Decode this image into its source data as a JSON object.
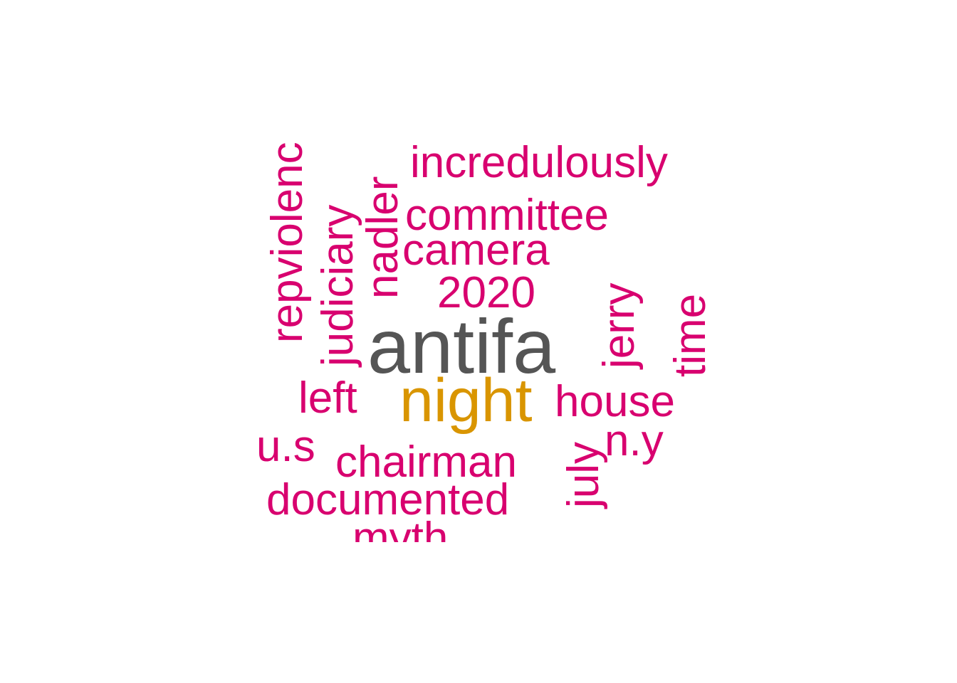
{
  "colors": {
    "primary": "#555555",
    "secondary": "#D99500",
    "tertiary": "#D8006F"
  },
  "words": [
    {
      "key": "antifa",
      "text": "antifa",
      "weight": 1,
      "color": "primary"
    },
    {
      "key": "night",
      "text": "night",
      "weight": 2,
      "color": "secondary"
    },
    {
      "key": "incredulously",
      "text": "incredulously",
      "weight": 3,
      "color": "tertiary"
    },
    {
      "key": "committee",
      "text": "committee",
      "weight": 3,
      "color": "tertiary"
    },
    {
      "key": "camera",
      "text": "camera",
      "weight": 3,
      "color": "tertiary"
    },
    {
      "key": "2020",
      "text": "2020",
      "weight": 3,
      "color": "tertiary"
    },
    {
      "key": "house",
      "text": "house",
      "weight": 3,
      "color": "tertiary"
    },
    {
      "key": "left",
      "text": "left",
      "weight": 3,
      "color": "tertiary"
    },
    {
      "key": "u-s",
      "text": "u.s",
      "weight": 3,
      "color": "tertiary"
    },
    {
      "key": "n-y",
      "text": "n.y",
      "weight": 3,
      "color": "tertiary"
    },
    {
      "key": "chairman",
      "text": "chairman",
      "weight": 3,
      "color": "tertiary"
    },
    {
      "key": "documented",
      "text": "documented",
      "weight": 3,
      "color": "tertiary"
    },
    {
      "key": "myth",
      "text": "myth",
      "weight": 3,
      "color": "tertiary"
    },
    {
      "key": "repviolenc",
      "text": "repviolenc",
      "weight": 3,
      "color": "tertiary"
    },
    {
      "key": "judiciary",
      "text": "judiciary",
      "weight": 3,
      "color": "tertiary"
    },
    {
      "key": "nadler",
      "text": "nadler",
      "weight": 3,
      "color": "tertiary"
    },
    {
      "key": "jerry",
      "text": "jerry",
      "weight": 3,
      "color": "tertiary"
    },
    {
      "key": "time",
      "text": "time",
      "weight": 3,
      "color": "tertiary"
    },
    {
      "key": "july",
      "text": "july",
      "weight": 3,
      "color": "tertiary"
    }
  ]
}
